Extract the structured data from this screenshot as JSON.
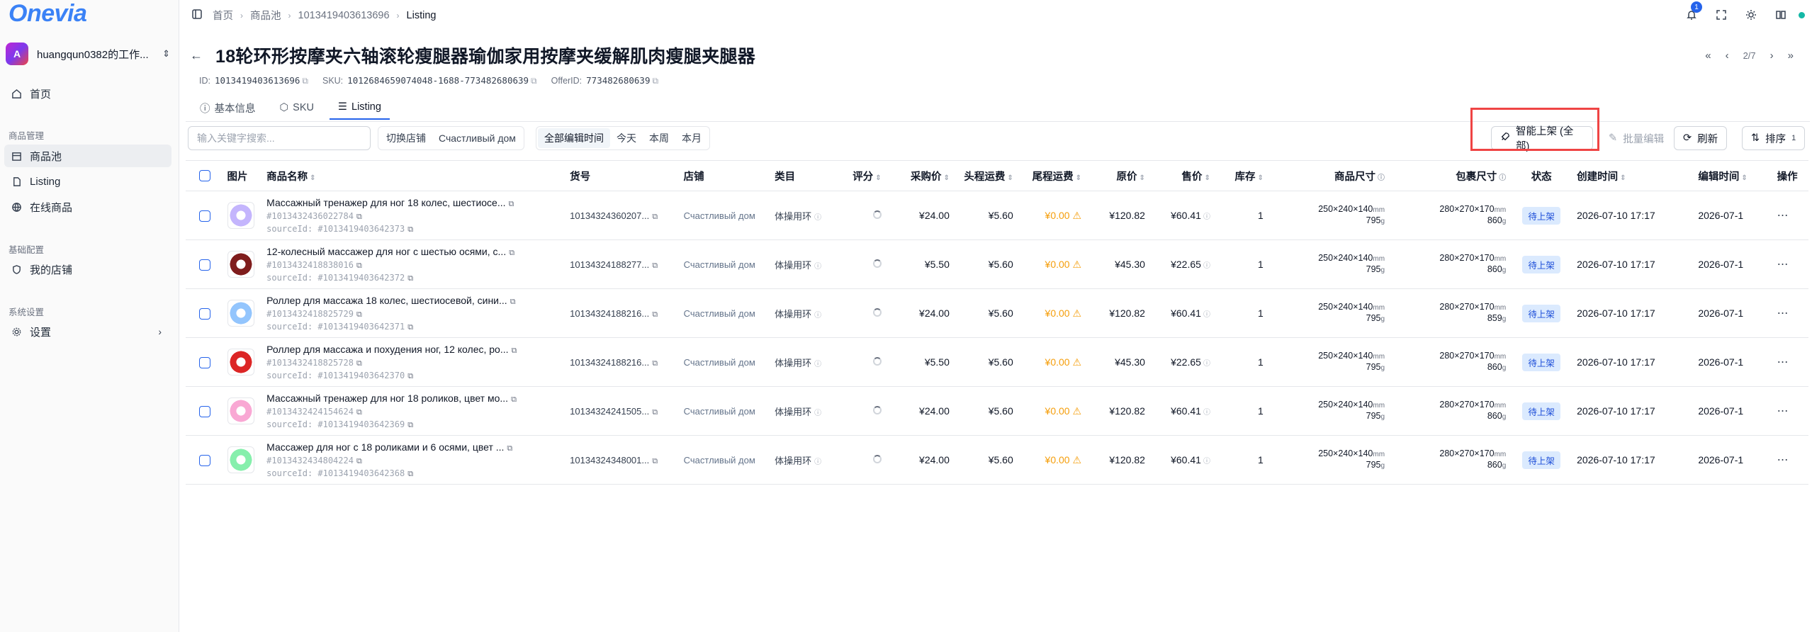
{
  "app": {
    "logo": "Onevia",
    "workspace": "huangqun0382的工作...",
    "workspace_avatar": "A"
  },
  "sidebar": {
    "home": "首页",
    "section_products": "商品管理",
    "items_products": [
      "商品池",
      "Listing",
      "在线商品"
    ],
    "section_config": "基础配置",
    "my_shop": "我的店铺",
    "section_system": "系统设置",
    "settings": "设置"
  },
  "breadcrumb": [
    "首页",
    "商品池",
    "1013419403613696",
    "Listing"
  ],
  "topbar": {
    "notif_count": "1"
  },
  "product": {
    "title": "18轮环形按摩夹六轴滚轮瘦腿器瑜伽家用按摩夹缓解肌肉瘦腿夹腿器",
    "id_label": "ID:",
    "id": "1013419403613696",
    "sku_label": "SKU:",
    "sku": "1012684659074048-1688-773482680639",
    "offer_label": "OfferID:",
    "offer": "773482680639"
  },
  "pager": {
    "first": "«",
    "prev": "‹",
    "page": "2/7",
    "next": "›",
    "last": "»"
  },
  "tabs": [
    "基本信息",
    "SKU",
    "Listing"
  ],
  "toolbar": {
    "search_placeholder": "输入关键字搜索...",
    "switch_shop": "切换店铺",
    "shop_name": "Счастливый дом",
    "time_filters": [
      "全部编辑时间",
      "今天",
      "本周",
      "本月"
    ],
    "smart_list": "智能上架 (全部)",
    "batch_edit": "批量编辑",
    "refresh": "刷新",
    "sort": "排序",
    "sort_count": "1"
  },
  "table": {
    "headers": [
      "图片",
      "商品名称",
      "货号",
      "店铺",
      "类目",
      "评分",
      "采购价",
      "头程运费",
      "尾程运费",
      "原价",
      "售价",
      "库存",
      "商品尺寸",
      "包裹尺寸",
      "状态",
      "创建时间",
      "编辑时间",
      "操作"
    ],
    "rows": [
      {
        "name": "Массажный тренажер для ног 18 колес, шестиосе...",
        "id": "#1013432436022784",
        "source": "sourceId: #1013419403642373",
        "sku": "10134324360207...",
        "shop": "Счастливый дом",
        "cat": "体操用环",
        "purchase": "¥24.00",
        "first": "¥5.60",
        "last": "¥0.00",
        "orig": "¥120.82",
        "sale": "¥60.41",
        "stock": "1",
        "dims": "250×240×140",
        "dimw": "795",
        "pkg": "280×270×170",
        "pkgw": "860",
        "status": "待上架",
        "created": "2026-07-10 17:17",
        "edited": "2026-07-1",
        "color": "#c4b5fd"
      },
      {
        "name": "12-колесный массажер для ног с шестью осями, с...",
        "id": "#1013432418838016",
        "source": "sourceId: #1013419403642372",
        "sku": "10134324188277...",
        "shop": "Счастливый дом",
        "cat": "体操用环",
        "purchase": "¥5.50",
        "first": "¥5.60",
        "last": "¥0.00",
        "orig": "¥45.30",
        "sale": "¥22.65",
        "stock": "1",
        "dims": "250×240×140",
        "dimw": "795",
        "pkg": "280×270×170",
        "pkgw": "860",
        "status": "待上架",
        "created": "2026-07-10 17:17",
        "edited": "2026-07-1",
        "color": "#7f1d1d"
      },
      {
        "name": "Роллер для массажа 18 колес, шестиосевой, сини...",
        "id": "#1013432418825729",
        "source": "sourceId: #1013419403642371",
        "sku": "10134324188216...",
        "shop": "Счастливый дом",
        "cat": "体操用环",
        "purchase": "¥24.00",
        "first": "¥5.60",
        "last": "¥0.00",
        "orig": "¥120.82",
        "sale": "¥60.41",
        "stock": "1",
        "dims": "250×240×140",
        "dimw": "795",
        "pkg": "280×270×170",
        "pkgw": "859",
        "status": "待上架",
        "created": "2026-07-10 17:17",
        "edited": "2026-07-1",
        "color": "#93c5fd"
      },
      {
        "name": "Роллер для массажа и похудения ног, 12 колес, ро...",
        "id": "#1013432418825728",
        "source": "sourceId: #1013419403642370",
        "sku": "10134324188216...",
        "shop": "Счастливый дом",
        "cat": "体操用环",
        "purchase": "¥5.50",
        "first": "¥5.60",
        "last": "¥0.00",
        "orig": "¥45.30",
        "sale": "¥22.65",
        "stock": "1",
        "dims": "250×240×140",
        "dimw": "795",
        "pkg": "280×270×170",
        "pkgw": "860",
        "status": "待上架",
        "created": "2026-07-10 17:17",
        "edited": "2026-07-1",
        "color": "#dc2626"
      },
      {
        "name": "Массажный тренажер для ног 18 роликов, цвет мо...",
        "id": "#1013432424154624",
        "source": "sourceId: #1013419403642369",
        "sku": "10134324241505...",
        "shop": "Счастливый дом",
        "cat": "体操用环",
        "purchase": "¥24.00",
        "first": "¥5.60",
        "last": "¥0.00",
        "orig": "¥120.82",
        "sale": "¥60.41",
        "stock": "1",
        "dims": "250×240×140",
        "dimw": "795",
        "pkg": "280×270×170",
        "pkgw": "860",
        "status": "待上架",
        "created": "2026-07-10 17:17",
        "edited": "2026-07-1",
        "color": "#f9a8d4"
      },
      {
        "name": "Массажер для ног с 18 роликами и 6 осями, цвет ...",
        "id": "#1013432434804224",
        "source": "sourceId: #1013419403642368",
        "sku": "10134324348001...",
        "shop": "Счастливый дом",
        "cat": "体操用环",
        "purchase": "¥24.00",
        "first": "¥5.60",
        "last": "¥0.00",
        "orig": "¥120.82",
        "sale": "¥60.41",
        "stock": "1",
        "dims": "250×240×140",
        "dimw": "795",
        "pkg": "280×270×170",
        "pkgw": "860",
        "status": "待上架",
        "created": "2026-07-10 17:17",
        "edited": "2026-07-1",
        "color": "#86efac"
      }
    ],
    "unit_mm": "mm",
    "unit_g": "g"
  }
}
